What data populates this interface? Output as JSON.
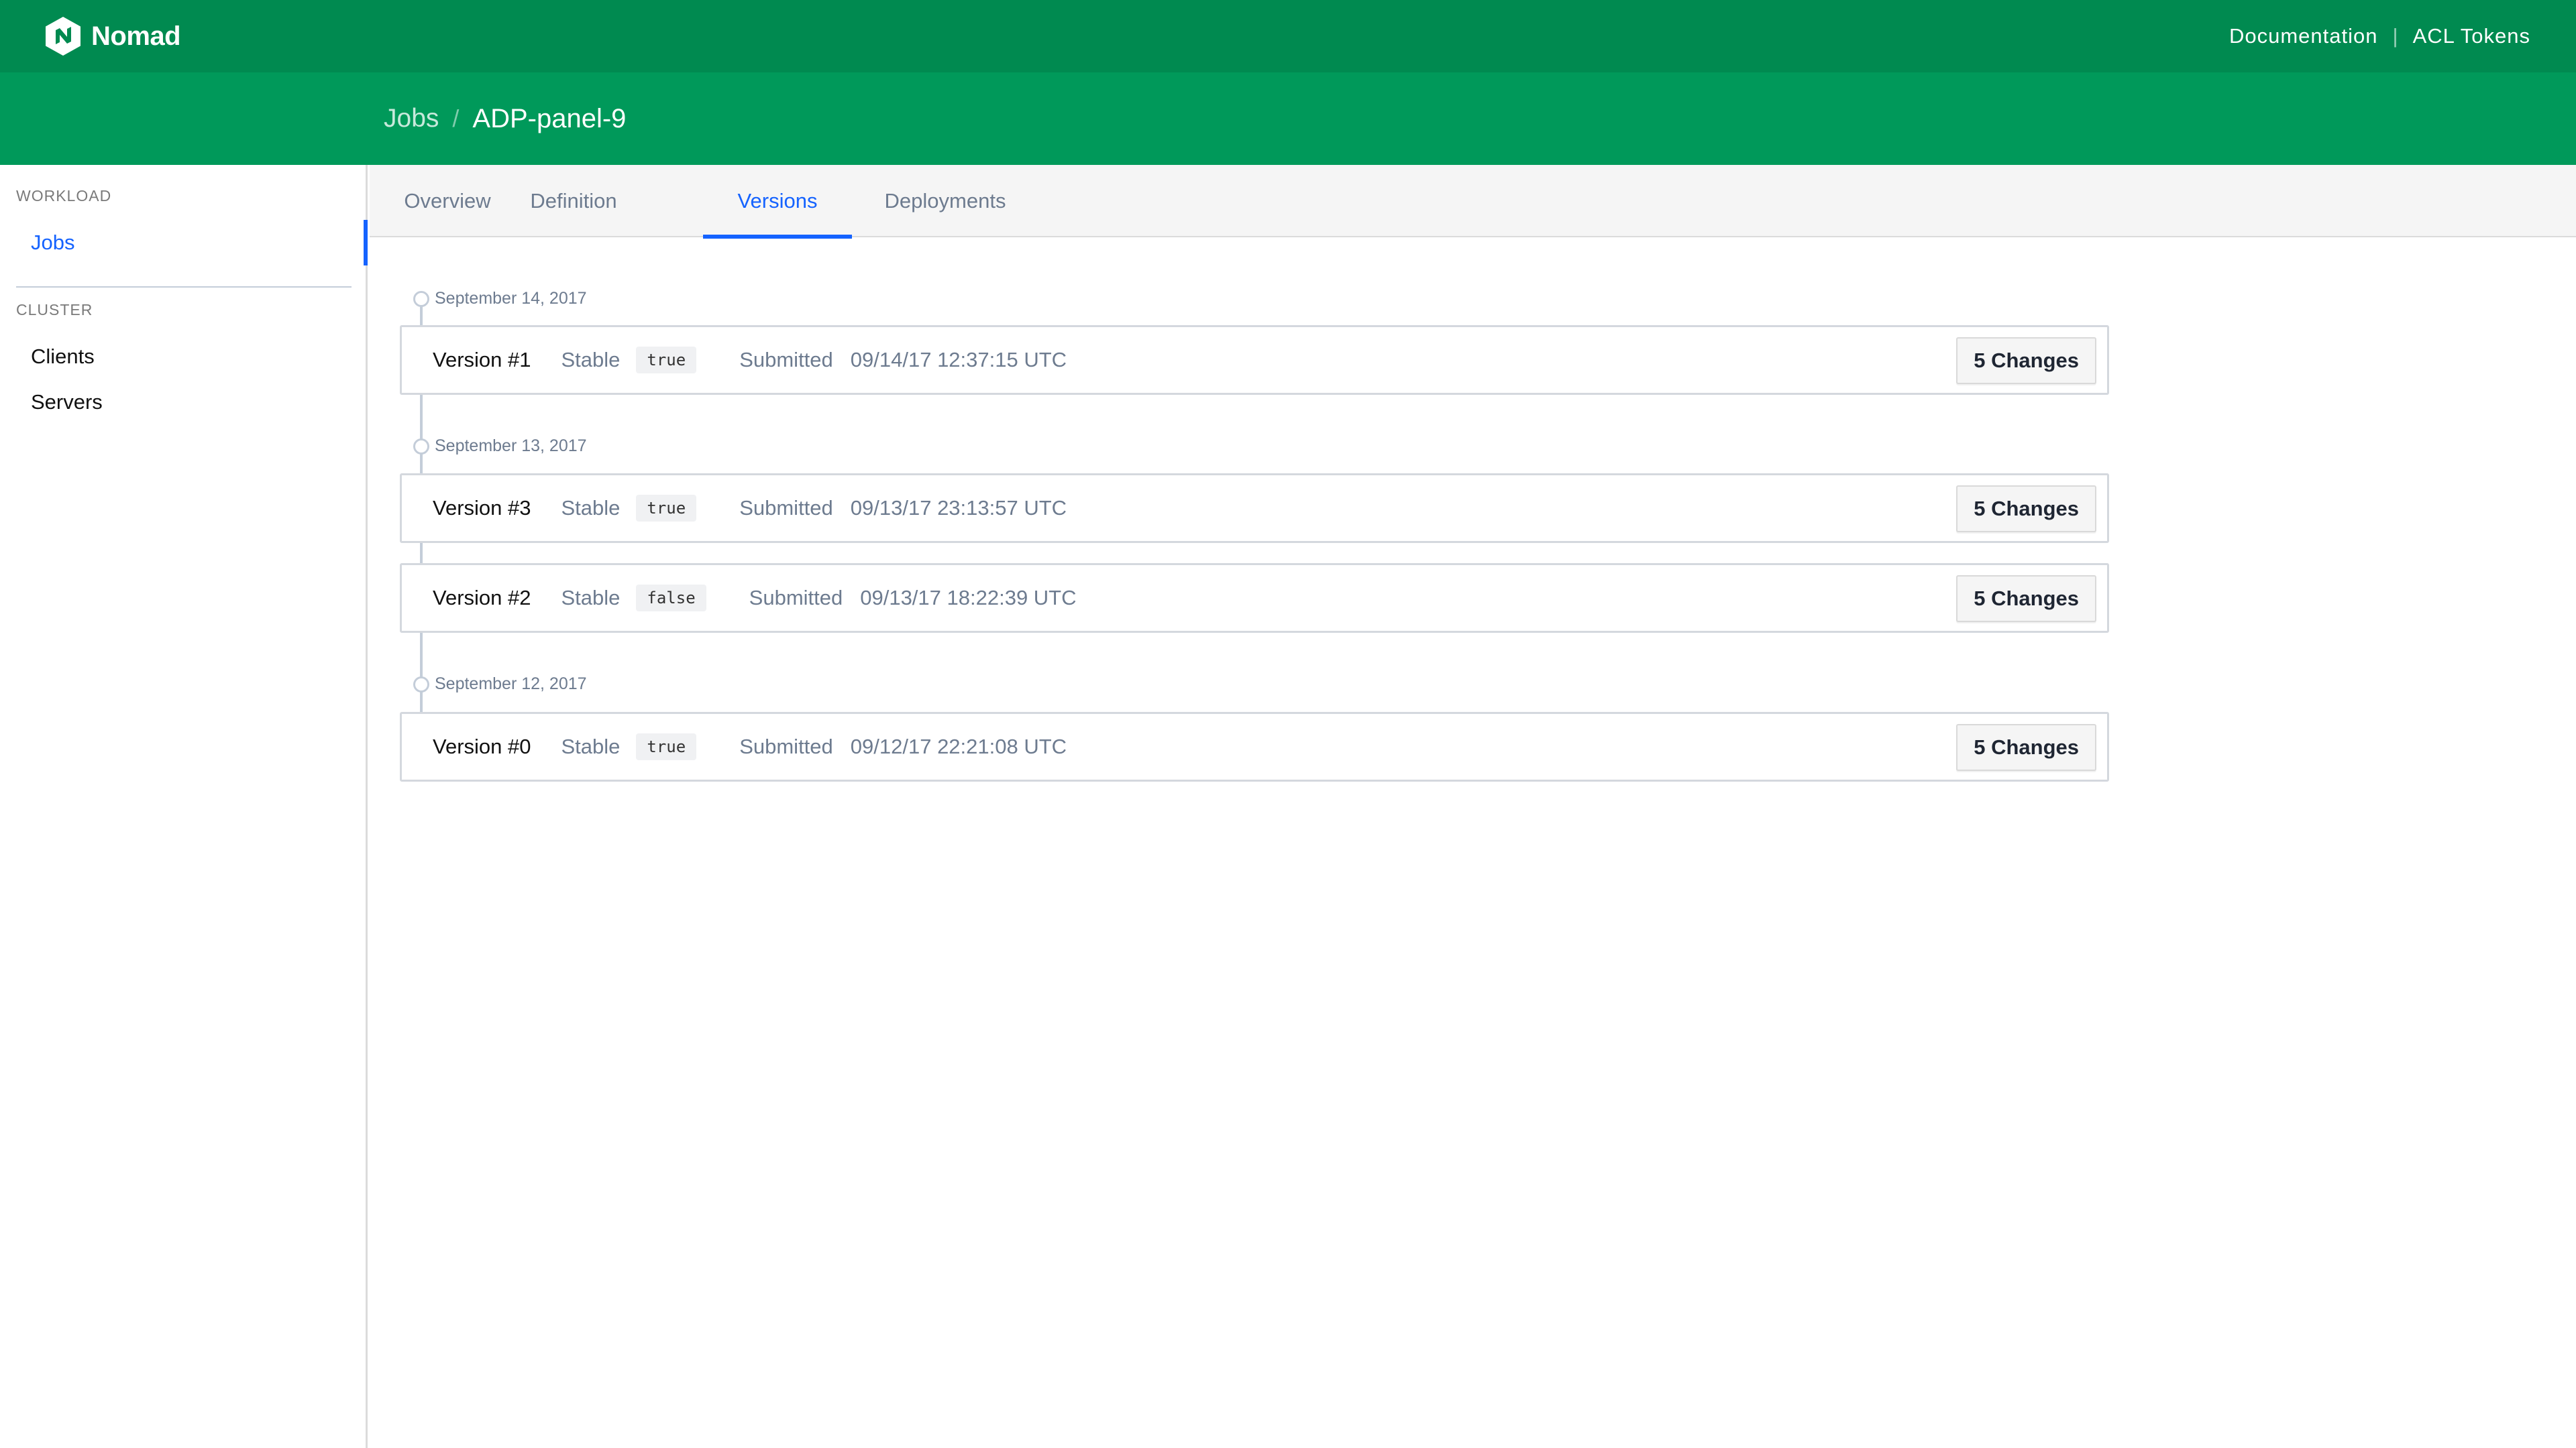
{
  "app": {
    "name": "Nomad",
    "nav_links": [
      "Documentation",
      "ACL Tokens"
    ]
  },
  "breadcrumb": {
    "parent": "Jobs",
    "current": "ADP-panel-9"
  },
  "sidebar": {
    "sections": [
      {
        "label": "WORKLOAD",
        "items": [
          {
            "label": "Jobs",
            "active": true
          }
        ]
      },
      {
        "label": "CLUSTER",
        "items": [
          {
            "label": "Clients",
            "active": false
          },
          {
            "label": "Servers",
            "active": false
          }
        ]
      }
    ]
  },
  "tabs": [
    {
      "label": "Overview",
      "active": false
    },
    {
      "label": "Definition",
      "active": false
    },
    {
      "label": "Versions",
      "active": true
    },
    {
      "label": "Deployments",
      "active": false
    }
  ],
  "timeline": [
    {
      "date": "September 14, 2017",
      "versions": [
        {
          "name": "Version #1",
          "stable_label": "Stable",
          "stable": "true",
          "submitted_label": "Submitted",
          "submitted": "09/14/17 12:37:15 UTC",
          "changes": "5 Changes"
        }
      ]
    },
    {
      "date": "September 13, 2017",
      "versions": [
        {
          "name": "Version #3",
          "stable_label": "Stable",
          "stable": "true",
          "submitted_label": "Submitted",
          "submitted": "09/13/17 23:13:57 UTC",
          "changes": "5 Changes"
        },
        {
          "name": "Version #2",
          "stable_label": "Stable",
          "stable": "false",
          "submitted_label": "Submitted",
          "submitted": "09/13/17 18:22:39 UTC",
          "changes": "5 Changes"
        }
      ]
    },
    {
      "date": "September 12, 2017",
      "versions": [
        {
          "name": "Version #0",
          "stable_label": "Stable",
          "stable": "true",
          "submitted_label": "Submitted",
          "submitted": "09/12/17 22:21:08 UTC",
          "changes": "5 Changes"
        }
      ]
    }
  ],
  "colors": {
    "topnav": "#008a50",
    "subheader": "#00995a",
    "accent": "#1563ff"
  }
}
